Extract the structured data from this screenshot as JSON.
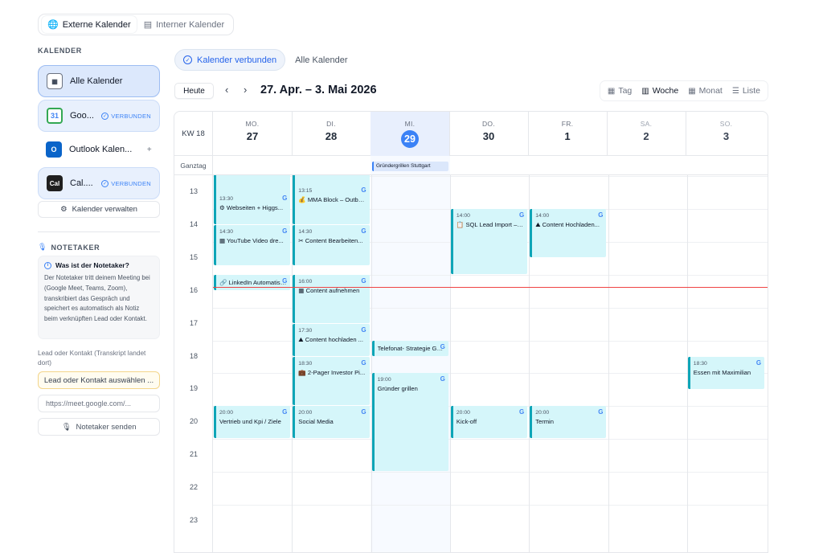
{
  "top_tabs": [
    {
      "label": "Externe Kalender",
      "active": true
    },
    {
      "label": "Interner Kalender",
      "active": false
    }
  ],
  "sidebar": {
    "section_label": "KALENDER",
    "items": [
      {
        "label": "Alle Kalender",
        "status": ""
      },
      {
        "label": "Goo...",
        "status": "VERBUNDEN"
      },
      {
        "label": "Outlook Kalen...",
        "status": "+"
      },
      {
        "label": "Cal....",
        "status": "VERBUNDEN"
      }
    ],
    "manage_label": "Kalender verwalten",
    "notetaker": {
      "label": "NOTETAKER",
      "info_title": "Was ist der Notetaker?",
      "info_text": "Der Notetaker tritt deinem Meeting bei (Google Meet, Teams, Zoom), transkribiert das Gespräch und speichert es automatisch als Notiz beim verknüpften Lead oder Kontakt.",
      "lead_label": "Lead oder Kontakt (Transkript landet dort)",
      "lead_button": "Lead oder Kontakt auswählen ...",
      "meet_placeholder": "https://meet.google.com/...",
      "send_button": "Notetaker senden"
    }
  },
  "filter": {
    "active_label": "Kalender verbunden",
    "other_label": "Alle Kalender"
  },
  "toolbar": {
    "today": "Heute",
    "prev": "‹",
    "next": "›",
    "range": "27. Apr. – 3. Mai 2026",
    "views": [
      {
        "label": "Tag",
        "icon": "calendar-day-icon",
        "active": false
      },
      {
        "label": "Woche",
        "icon": "calendar-week-icon",
        "active": true
      },
      {
        "label": "Monat",
        "icon": "calendar-month-icon",
        "active": false
      },
      {
        "label": "Liste",
        "icon": "list-icon",
        "active": false
      }
    ]
  },
  "calendar": {
    "week_label": "KW 18",
    "allday_label": "Ganztag",
    "days": [
      {
        "name": "MO.",
        "num": "27"
      },
      {
        "name": "DI.",
        "num": "28"
      },
      {
        "name": "MI.",
        "num": "29",
        "today": true
      },
      {
        "name": "DO.",
        "num": "30"
      },
      {
        "name": "FR.",
        "num": "1"
      },
      {
        "name": "SA.",
        "num": "2"
      },
      {
        "name": "SO.",
        "num": "3"
      }
    ],
    "hours": [
      "13",
      "14",
      "15",
      "16",
      "17",
      "18",
      "19",
      "20",
      "21",
      "22",
      "23"
    ],
    "allday_events": [
      {
        "day": 2,
        "title": "Gründergrillen Stuttgart"
      }
    ],
    "events": [
      {
        "day": 0,
        "start": 13.5,
        "end": 14.5,
        "time": "13:30",
        "title": "⚙ Webseiten + Higgs...",
        "g": "G"
      },
      {
        "day": 0,
        "start": 14.5,
        "end": 15.75,
        "time": "14:30",
        "title": "▦ YouTube Video dre...",
        "g": "G"
      },
      {
        "day": 0,
        "start": 16,
        "end": 16.5,
        "time": "",
        "title": "🔗 LinkedIn Automatisier...",
        "g": "G"
      },
      {
        "day": 0,
        "start": 20,
        "end": 21,
        "time": "20:00",
        "title": "Vertrieb und Kpi / Ziele",
        "g": "G"
      },
      {
        "day": 1,
        "start": 13.25,
        "end": 14.5,
        "time": "13:15",
        "title": "💰 MMA Block – Outbo...",
        "g": "G"
      },
      {
        "day": 1,
        "start": 14.5,
        "end": 15.75,
        "time": "14:30",
        "title": "✂ Content Bearbeiten...",
        "g": "G"
      },
      {
        "day": 1,
        "start": 16,
        "end": 17.5,
        "time": "16:00",
        "title": "▦ Content aufnehmen",
        "g": "G"
      },
      {
        "day": 1,
        "start": 17.5,
        "end": 18.5,
        "time": "17:30",
        "title": "⛰ Content hochladen ...",
        "g": "G"
      },
      {
        "day": 1,
        "start": 18.5,
        "end": 20,
        "time": "18:30",
        "title": "💼 2-Pager Investor Pi...",
        "g": "G"
      },
      {
        "day": 1,
        "start": 20,
        "end": 21,
        "time": "20:00",
        "title": "Social Media",
        "g": "G"
      },
      {
        "day": 2,
        "start": 18,
        "end": 18.5,
        "time": "",
        "title": "Telefonat- Strategie Gesp...",
        "g": "G"
      },
      {
        "day": 2,
        "start": 19,
        "end": 22,
        "time": "19:00",
        "title": "Gründer grillen",
        "g": "G"
      },
      {
        "day": 3,
        "start": 14,
        "end": 16,
        "time": "14:00",
        "title": "📋 SQL Lead Import – K...",
        "g": "G"
      },
      {
        "day": 3,
        "start": 20,
        "end": 21,
        "time": "20:00",
        "title": "Kick-off",
        "g": "G"
      },
      {
        "day": 4,
        "start": 14,
        "end": 15.5,
        "time": "14:00",
        "title": "⛰ Content Hochladen...",
        "g": "G"
      },
      {
        "day": 4,
        "start": 20,
        "end": 21,
        "time": "20:00",
        "title": "Termin",
        "g": "G"
      },
      {
        "day": 6,
        "start": 18.5,
        "end": 19.5,
        "time": "18:30",
        "title": "Essen mit Maximilian",
        "g": "G"
      }
    ],
    "now_hour": 15.8
  }
}
